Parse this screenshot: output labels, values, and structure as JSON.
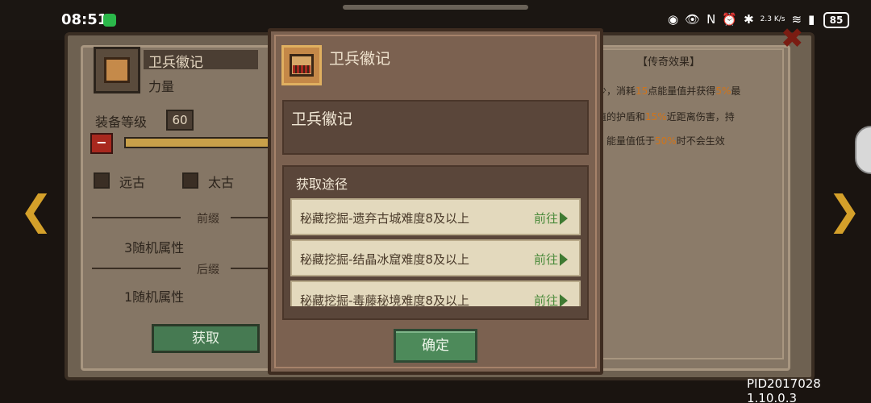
{
  "status_bar": {
    "time": "08:51",
    "net_speed": "2.3\nK/s",
    "battery": "85"
  },
  "background": {
    "item_name": "卫兵徽记",
    "item_sub": "力量",
    "equip_level_label": "装备等级",
    "equip_level": "60",
    "minus": "−",
    "option_ancient": "远古",
    "option_primal": "太古",
    "prefix_label": "前缀",
    "prefix_value": "3随机属性",
    "suffix_label": "后缀",
    "suffix_value": "1随机属性",
    "get_button": "获取",
    "legend_title": "【传奇效果】",
    "legend_line1a": "少，消耗",
    "legend_line1b": "15",
    "legend_line1c": "点能量值并获得",
    "legend_line1d": "5%",
    "legend_line1e": "最",
    "legend_line2a": "值的护盾和",
    "legend_line2b": "15%",
    "legend_line2c": "近距离伤害，持",
    "legend_line3a": "；能量值低于",
    "legend_line3b": "50%",
    "legend_line3c": "时不会生效"
  },
  "modal": {
    "title": "卫兵徽记",
    "item_name": "卫兵徽记",
    "sources_title": "获取途径",
    "sources": [
      {
        "label": "秘藏挖掘-遗弃古城难度8及以上",
        "action": "前往"
      },
      {
        "label": "秘藏挖掘-结晶冰窟难度8及以上",
        "action": "前往"
      },
      {
        "label": "秘藏挖掘-毒藤秘境难度8及以上",
        "action": "前往"
      }
    ],
    "confirm": "确定"
  },
  "build_id": "PID2017028 1.10.0.3",
  "colors": {
    "accent_green": "#4d8a5a",
    "highlight_orange": "#d0741a",
    "modal_bg": "#7b6150"
  }
}
